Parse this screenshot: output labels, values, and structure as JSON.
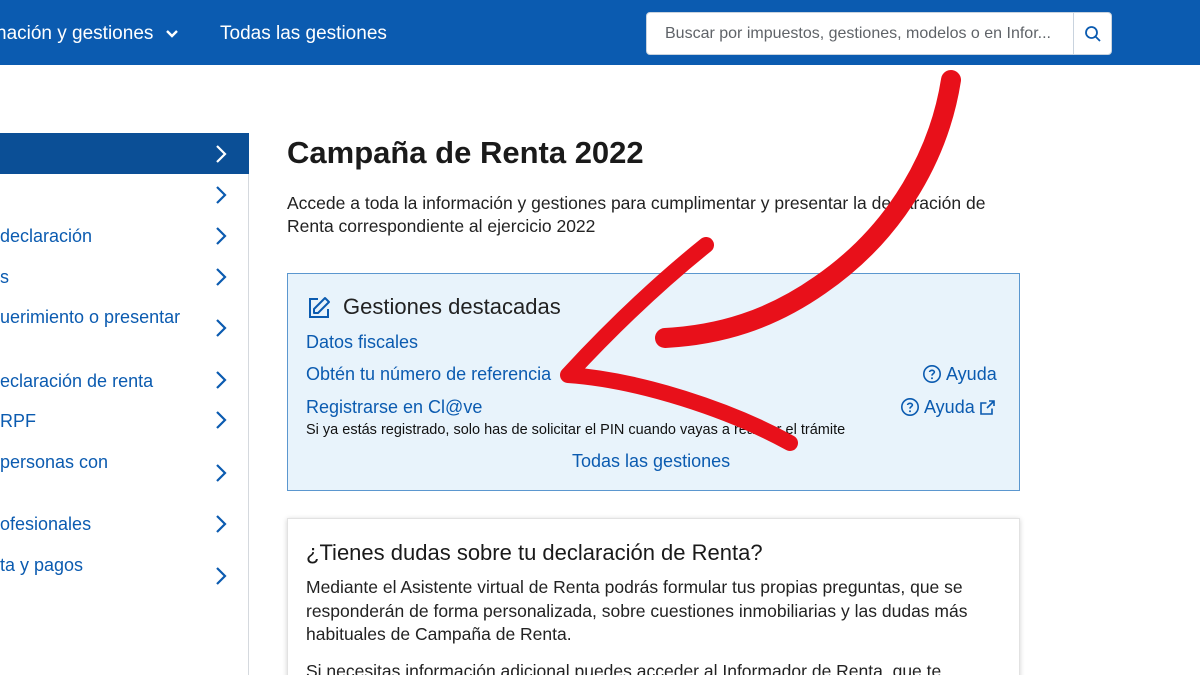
{
  "topbar": {
    "menu_label": "nación y gestiones",
    "all_label": "Todas las gestiones",
    "search_placeholder": "Buscar por impuestos, gestiones, modelos o en Infor..."
  },
  "sidebar": {
    "items": [
      {
        "label": ""
      },
      {
        "label": ""
      },
      {
        "label": " declaración"
      },
      {
        "label": "s"
      },
      {
        "label": "uerimiento o presentar"
      },
      {
        "label": "eclaración de renta"
      },
      {
        "label": "RPF"
      },
      {
        "label": "personas con"
      },
      {
        "label": "ofesionales"
      },
      {
        "label": "ta y pagos"
      }
    ]
  },
  "main": {
    "title": "Campaña de Renta 2022",
    "intro": "Accede a toda la información y gestiones para cumplimentar y presentar la declaración de Renta correspondiente al ejercicio 2022",
    "featured": {
      "title": "Gestiones destacadas",
      "link1": "Datos fiscales",
      "link2": "Obtén tu número de referencia",
      "link3": "Registrarse en Cl@ve",
      "help1": "Ayuda",
      "help2": "Ayuda",
      "note": "Si ya estás registrado, solo has de solicitar el PIN cuando vayas a realizar el trámite",
      "all_link": "Todas las gestiones"
    },
    "doubts": {
      "title": "¿Tienes dudas sobre tu declaración de Renta?",
      "text": "Mediante el Asistente virtual de Renta podrás formular tus propias preguntas, que se responderán de forma personalizada, sobre cuestiones inmobiliarias y las dudas más habituales de Campaña de Renta.",
      "text2": "Si necesitas información adicional puedes acceder al Informador de Renta, que te"
    }
  },
  "colors": {
    "brand_blue": "#0b5bb0",
    "active_blue": "#0b4f96",
    "box_bg": "#e8f3fb",
    "annotation_red": "#e8101a"
  },
  "icons": [
    "chevron-down-icon",
    "search-icon",
    "chevron-right-icon",
    "edit-icon",
    "help-circle-icon",
    "external-link-icon",
    "red-arrow-annotation"
  ]
}
